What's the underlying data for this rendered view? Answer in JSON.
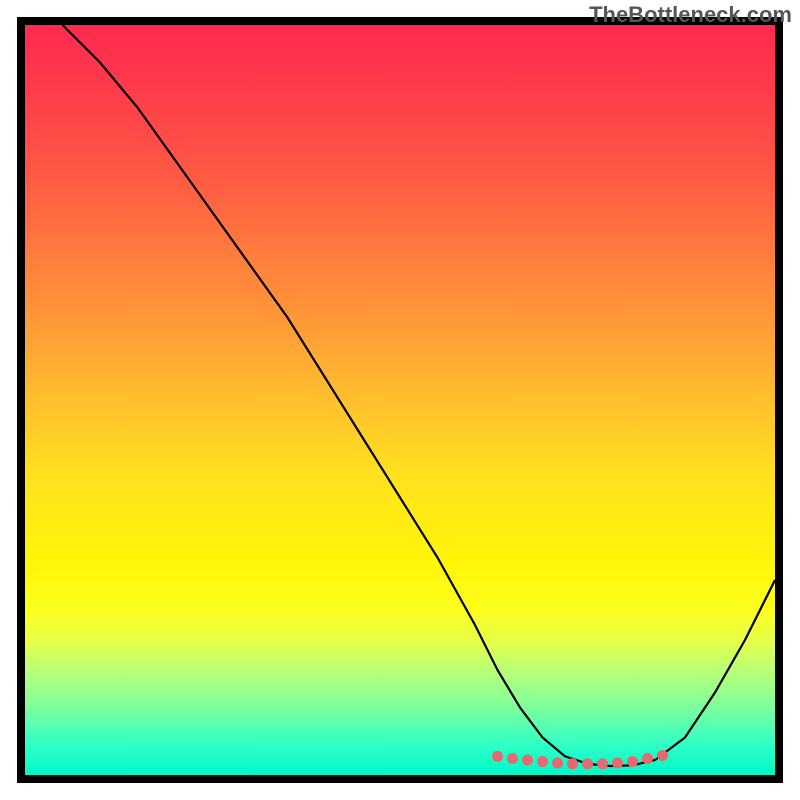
{
  "watermark": "TheBottleneck.com",
  "chart_data": {
    "type": "line",
    "title": "",
    "xlabel": "",
    "ylabel": "",
    "xlim": [
      0,
      100
    ],
    "ylim": [
      0,
      100
    ],
    "series": [
      {
        "name": "curve",
        "x": [
          5,
          10,
          15,
          20,
          25,
          30,
          35,
          40,
          45,
          50,
          55,
          60,
          63,
          66,
          69,
          72,
          75,
          78,
          81,
          84,
          88,
          92,
          96,
          100
        ],
        "y": [
          100,
          95,
          89,
          82,
          75,
          68,
          61,
          53,
          45,
          37,
          29,
          20,
          14,
          9,
          5,
          2.5,
          1.5,
          1.2,
          1.3,
          2,
          5,
          11,
          18,
          26
        ]
      },
      {
        "name": "flat-dots",
        "x": [
          63,
          65,
          67,
          69,
          71,
          73,
          75,
          77,
          79,
          81,
          83,
          85
        ],
        "y": [
          2.5,
          2.2,
          2.0,
          1.8,
          1.6,
          1.5,
          1.5,
          1.5,
          1.6,
          1.8,
          2.2,
          2.6
        ]
      }
    ],
    "flat_region": {
      "x_start": 63,
      "x_end": 85
    },
    "colors": {
      "curve_stroke": "#000000",
      "dot_fill": "#e46a6f",
      "gradient_top": "#ff2a4f",
      "gradient_bottom": "#00f7c9"
    }
  }
}
